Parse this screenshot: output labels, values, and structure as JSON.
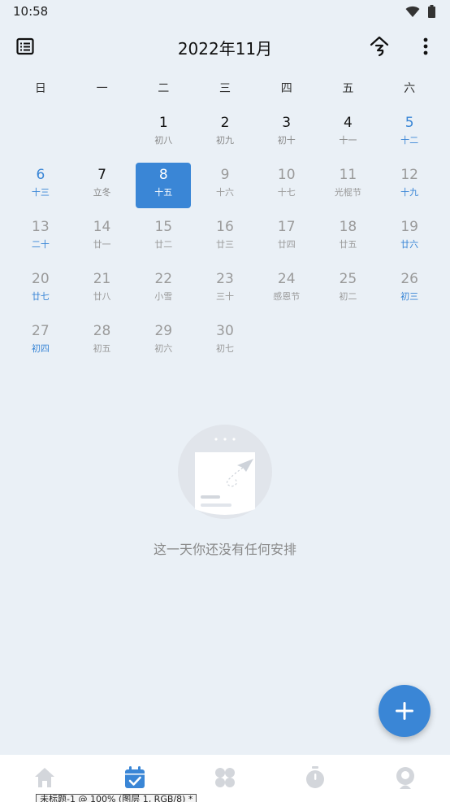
{
  "status_bar": {
    "time": "10:58",
    "icons": [
      "wifi-icon",
      "battery-icon"
    ]
  },
  "header": {
    "title": "2022年11月",
    "left_icon": "list-icon",
    "today_icon": "today-icon",
    "more_icon": "more-vert-icon"
  },
  "weekdays": [
    "日",
    "一",
    "二",
    "三",
    "四",
    "五",
    "六"
  ],
  "days": [
    {
      "day": "",
      "lunar": ""
    },
    {
      "day": "",
      "lunar": ""
    },
    {
      "day": "1",
      "lunar": "初八",
      "state": "current"
    },
    {
      "day": "2",
      "lunar": "初九",
      "state": "current"
    },
    {
      "day": "3",
      "lunar": "初十",
      "state": "current"
    },
    {
      "day": "4",
      "lunar": "十一",
      "state": "current"
    },
    {
      "day": "5",
      "lunar": "十二",
      "state": "current",
      "weekend": true
    },
    {
      "day": "6",
      "lunar": "十三",
      "state": "current",
      "weekend": true
    },
    {
      "day": "7",
      "lunar": "立冬",
      "state": "current"
    },
    {
      "day": "8",
      "lunar": "十五",
      "state": "selected"
    },
    {
      "day": "9",
      "lunar": "十六",
      "state": "past"
    },
    {
      "day": "10",
      "lunar": "十七",
      "state": "past"
    },
    {
      "day": "11",
      "lunar": "光棍节",
      "state": "past"
    },
    {
      "day": "12",
      "lunar": "十九",
      "state": "past",
      "weekend": true
    },
    {
      "day": "13",
      "lunar": "二十",
      "state": "past",
      "weekend": true
    },
    {
      "day": "14",
      "lunar": "廿一",
      "state": "past"
    },
    {
      "day": "15",
      "lunar": "廿二",
      "state": "past"
    },
    {
      "day": "16",
      "lunar": "廿三",
      "state": "past"
    },
    {
      "day": "17",
      "lunar": "廿四",
      "state": "past"
    },
    {
      "day": "18",
      "lunar": "廿五",
      "state": "past"
    },
    {
      "day": "19",
      "lunar": "廿六",
      "state": "past",
      "weekend": true
    },
    {
      "day": "20",
      "lunar": "廿七",
      "state": "past",
      "weekend": true
    },
    {
      "day": "21",
      "lunar": "廿八",
      "state": "past"
    },
    {
      "day": "22",
      "lunar": "小雪",
      "state": "past"
    },
    {
      "day": "23",
      "lunar": "三十",
      "state": "past"
    },
    {
      "day": "24",
      "lunar": "感恩节",
      "state": "past"
    },
    {
      "day": "25",
      "lunar": "初二",
      "state": "past"
    },
    {
      "day": "26",
      "lunar": "初三",
      "state": "past",
      "weekend": true
    },
    {
      "day": "27",
      "lunar": "初四",
      "state": "past",
      "weekend": true
    },
    {
      "day": "28",
      "lunar": "初五",
      "state": "past"
    },
    {
      "day": "29",
      "lunar": "初六",
      "state": "past"
    },
    {
      "day": "30",
      "lunar": "初七",
      "state": "past"
    }
  ],
  "empty_state": {
    "text": "这一天你还没有任何安排"
  },
  "fab": {
    "icon": "plus-icon"
  },
  "bottom_nav": [
    {
      "name": "home-icon",
      "active": false
    },
    {
      "name": "calendar-icon",
      "active": true
    },
    {
      "name": "apps-icon",
      "active": false
    },
    {
      "name": "timer-icon",
      "active": false
    },
    {
      "name": "profile-icon",
      "active": false
    }
  ],
  "overlay_tooltip": "未标题-1 @ 100% (图层 1, RGB/8) *",
  "colors": {
    "accent": "#3A86D6",
    "background": "#EAF0F6",
    "muted": "#9A9A9A",
    "nav_inactive": "#D3D6DB"
  }
}
